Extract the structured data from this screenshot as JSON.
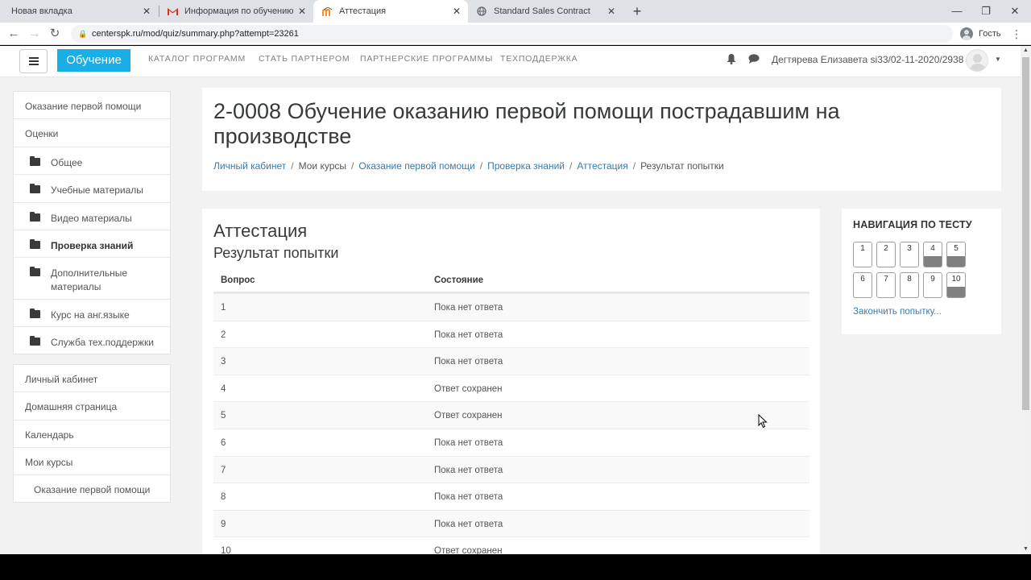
{
  "browser": {
    "tabs": [
      {
        "title": "Новая вкладка",
        "favicon": "none",
        "active": false
      },
      {
        "title": "Информация по обучению ОО",
        "favicon": "gmail-icon",
        "active": false
      },
      {
        "title": "Аттестация",
        "favicon": "moodle-icon",
        "active": true
      },
      {
        "title": "Standard Sales Contract",
        "favicon": "globe-icon",
        "active": false
      }
    ],
    "url": "centerspk.ru/mod/quiz/summary.php?attempt=23261",
    "profile_label": "Гость"
  },
  "navbar": {
    "brand": "Обучение",
    "links": [
      "КАТАЛОГ ПРОГРАММ",
      "СТАТЬ ПАРТНЕРОМ",
      "ПАРТНЕРСКИЕ ПРОГРАММЫ",
      "ТЕХПОДДЕРЖКА"
    ],
    "user_name": "Дегтярева Елизавета si33/02-11-2020/2938"
  },
  "drawer": {
    "course_block": [
      {
        "label": "Оказание первой помощи",
        "type": "plain"
      },
      {
        "label": "Оценки",
        "type": "plain"
      },
      {
        "label": "Общее",
        "type": "folder"
      },
      {
        "label": "Учебные материалы",
        "type": "folder"
      },
      {
        "label": "Видео материалы",
        "type": "folder"
      },
      {
        "label": "Проверка знаний",
        "type": "folder",
        "bold": true
      },
      {
        "label": "Дополнительные материалы",
        "type": "folder"
      },
      {
        "label": "Курс на анг.языке",
        "type": "folder"
      },
      {
        "label": "Служба тех.поддержки",
        "type": "folder"
      }
    ],
    "site_block": [
      {
        "label": "Личный кабинет",
        "type": "plain"
      },
      {
        "label": "Домашняя страница",
        "type": "plain"
      },
      {
        "label": "Календарь",
        "type": "plain"
      },
      {
        "label": "Мои курсы",
        "type": "plain"
      },
      {
        "label": "Оказание первой помощи",
        "type": "sub"
      }
    ]
  },
  "header": {
    "course_title": "2-0008 Обучение оказанию первой помощи пострадавшим на производстве",
    "breadcrumbs": [
      {
        "label": "Личный кабинет",
        "link": true
      },
      {
        "label": "Мои курсы",
        "link": false
      },
      {
        "label": "Оказание первой помощи",
        "link": true
      },
      {
        "label": "Проверка знаний",
        "link": true
      },
      {
        "label": "Аттестация",
        "link": true
      },
      {
        "label": "Результат попытки",
        "link": false
      }
    ]
  },
  "main": {
    "quiz_name": "Аттестация",
    "subtitle": "Результат попытки",
    "columns": [
      "Вопрос",
      "Состояние"
    ],
    "rows": [
      {
        "q": "1",
        "status": "Пока нет ответа"
      },
      {
        "q": "2",
        "status": "Пока нет ответа"
      },
      {
        "q": "3",
        "status": "Пока нет ответа"
      },
      {
        "q": "4",
        "status": "Ответ сохранен"
      },
      {
        "q": "5",
        "status": "Ответ сохранен"
      },
      {
        "q": "6",
        "status": "Пока нет ответа"
      },
      {
        "q": "7",
        "status": "Пока нет ответа"
      },
      {
        "q": "8",
        "status": "Пока нет ответа"
      },
      {
        "q": "9",
        "status": "Пока нет ответа"
      },
      {
        "q": "10",
        "status": "Ответ сохранен"
      }
    ]
  },
  "quiz_nav": {
    "title": "НАВИГАЦИЯ ПО ТЕСТУ",
    "buttons": [
      {
        "num": "1",
        "answered": false
      },
      {
        "num": "2",
        "answered": false
      },
      {
        "num": "3",
        "answered": false
      },
      {
        "num": "4",
        "answered": true
      },
      {
        "num": "5",
        "answered": true
      },
      {
        "num": "6",
        "answered": false
      },
      {
        "num": "7",
        "answered": false
      },
      {
        "num": "8",
        "answered": false
      },
      {
        "num": "9",
        "answered": false
      },
      {
        "num": "10",
        "answered": true
      }
    ],
    "finish_label": "Закончить попытку..."
  },
  "colors": {
    "brand": "#1aaee6",
    "link": "#3a7ba8",
    "answered_fill": "#808080"
  }
}
